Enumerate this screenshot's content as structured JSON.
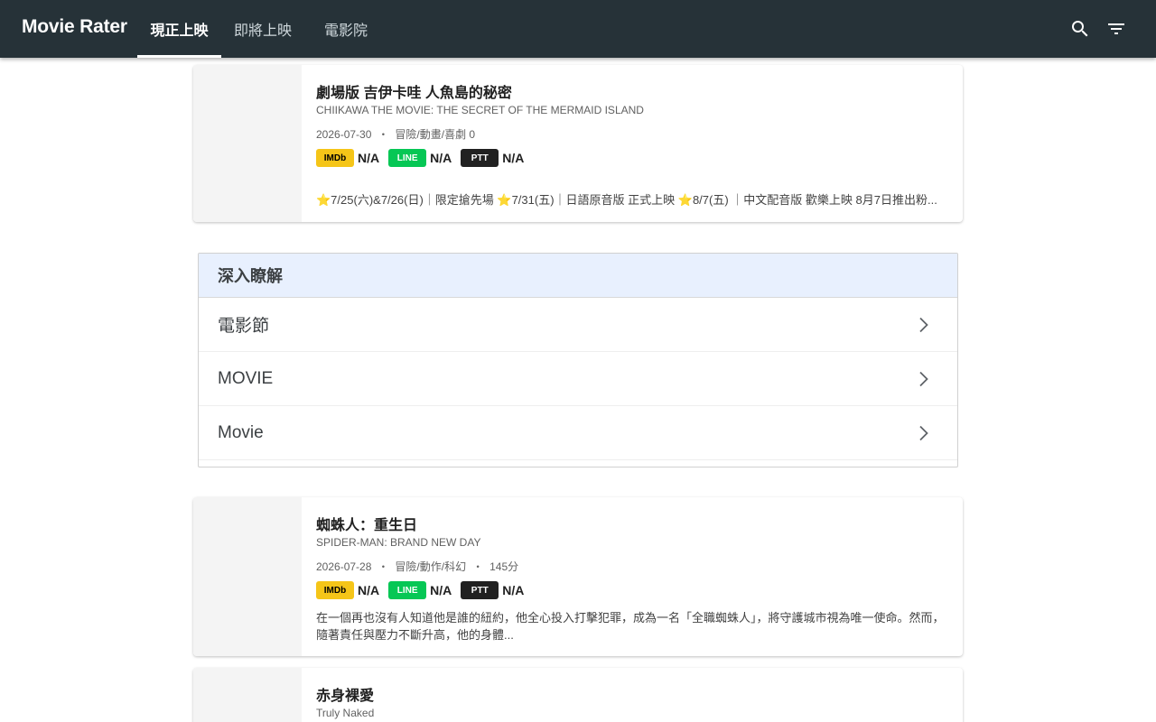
{
  "app": {
    "brand": "Movie Rater",
    "tabs": [
      {
        "label": "現正上映",
        "active": true
      },
      {
        "label": "即將上映",
        "active": false
      },
      {
        "label": "電影院",
        "active": false
      }
    ],
    "icons": {
      "search": "search-icon",
      "filter": "filter-list-icon"
    },
    "colors": {
      "topbar": "#263238",
      "imdb": "#f5c518",
      "line": "#06c755",
      "ptt": "#212121",
      "learn_header": "#e8f0fe"
    }
  },
  "movies": [
    {
      "title": "劇場版 吉伊卡哇 人魚島的秘密",
      "en_title": "CHIIKAWA THE MOVIE: THE SECRET OF THE MERMAID ISLAND",
      "date": "2026-07-30",
      "sep": "・",
      "genre_runtime": "冒險/動畫/喜劇 0",
      "ratings": [
        {
          "source": "IMDb",
          "value": "N/A"
        },
        {
          "source": "LINE",
          "value": "N/A"
        },
        {
          "source": "PTT",
          "value": "N/A"
        }
      ],
      "description": "⭐7/25(六)&7/26(日)｜限定搶先場 ⭐7/31(五)｜日語原音版 正式上映 ⭐8/7(五) ｜中文配音版 歡樂上映 8月7日推出粉..."
    },
    {
      "title": "蜘蛛人：重生日",
      "en_title": "SPIDER-MAN: BRAND NEW DAY",
      "date": "2026-07-28",
      "sep": "・",
      "genre": "冒險/動作/科幻",
      "runtime": "145分",
      "ratings": [
        {
          "source": "IMDb",
          "value": "N/A"
        },
        {
          "source": "LINE",
          "value": "N/A"
        },
        {
          "source": "PTT",
          "value": "N/A"
        }
      ],
      "description": "在一個再也沒有人知道他是誰的紐約，他全心投入打擊犯罪，成為一名「全職蜘蛛人」，將守護城市視為唯一使命。然而，隨著責任與壓力不斷升高，他的身體..."
    },
    {
      "title": "赤身裸愛",
      "en_title": "Truly Naked"
    }
  ],
  "learn_more": {
    "header": "深入瞭解",
    "items": [
      {
        "label": "電影節"
      },
      {
        "label": "MOVIE"
      },
      {
        "label": "Movie"
      }
    ]
  }
}
